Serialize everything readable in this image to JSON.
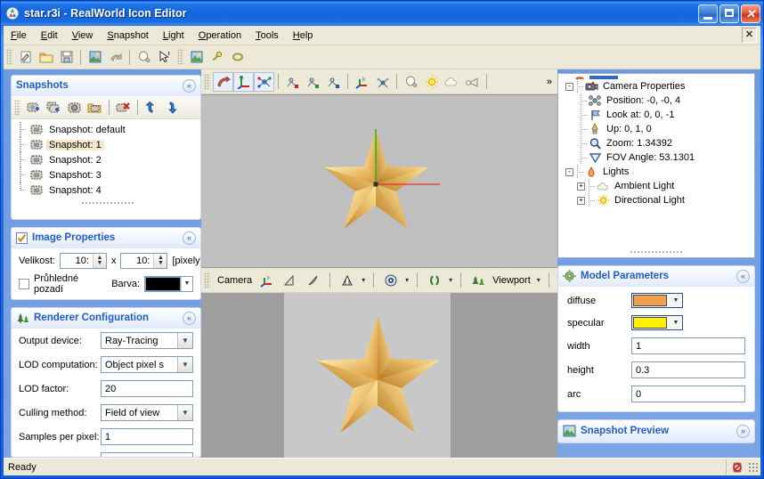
{
  "window": {
    "title": "star.r3i - RealWorld Icon Editor",
    "app_icon": "app-logo-icon",
    "minimize": "_",
    "maximize": "□",
    "close": "✕"
  },
  "menu": {
    "items": [
      {
        "label": "File",
        "accel": "F"
      },
      {
        "label": "Edit",
        "accel": "E"
      },
      {
        "label": "View",
        "accel": "V"
      },
      {
        "label": "Snapshot",
        "accel": "S"
      },
      {
        "label": "Light",
        "accel": "L"
      },
      {
        "label": "Operation",
        "accel": "O"
      },
      {
        "label": "Tools",
        "accel": "T"
      },
      {
        "label": "Help",
        "accel": "H"
      }
    ],
    "close_label": "✕"
  },
  "toolbar": {
    "buttons": [
      "new-document-icon",
      "open-folder-icon",
      "save-disk-icon",
      "export-image-icon",
      "undo-icon",
      "lightbulb-icon",
      "pointer-select-icon",
      "image-layer-icon",
      "tool-wand-icon",
      "loop-icon"
    ]
  },
  "snapshots_panel": {
    "title": "Snapshots",
    "collapse_glyph": "«",
    "toolbar_buttons": [
      "add-snapshot-icon",
      "duplicate-snapshot-icon",
      "edit-snapshot-icon",
      "open-snapshot-icon",
      "delete-snapshot-icon",
      "move-up-icon",
      "move-down-icon"
    ],
    "items": [
      {
        "label": "Snapshot: default",
        "selected": false
      },
      {
        "label": "Snapshot: 1",
        "selected": true
      },
      {
        "label": "Snapshot: 2",
        "selected": false
      },
      {
        "label": "Snapshot: 3",
        "selected": false
      },
      {
        "label": "Snapshot: 4",
        "selected": false
      }
    ]
  },
  "image_properties_panel": {
    "title": "Image Properties",
    "checkbox_icon": "checked-box-icon",
    "collapse_glyph": "«",
    "size_label": "Velikost:",
    "width_value": "10:",
    "separator": "x",
    "height_value": "10:",
    "units": "[pixely]",
    "transparent_label": "Průhledné pozadí",
    "transparent_checked": false,
    "color_label": "Barva:",
    "color_value": "#000000"
  },
  "renderer_panel": {
    "title": "Renderer Configuration",
    "icon": "trees-icon",
    "collapse_glyph": "«",
    "fields": [
      {
        "label": "Output device:",
        "value": "Ray-Tracing",
        "type": "select"
      },
      {
        "label": "LOD computation:",
        "value": "Object pixel s",
        "type": "select"
      },
      {
        "label": "LOD factor:",
        "value": "20",
        "type": "text"
      },
      {
        "label": "Culling method:",
        "value": "Field of view ",
        "type": "select"
      },
      {
        "label": "Samples per pixel:",
        "value": "1",
        "type": "text"
      }
    ]
  },
  "viewport": {
    "top_toolbar": [
      "rotate-object-icon",
      "move-axes-icon",
      "scale-object-icon",
      "rotate-x-icon",
      "rotate-y-icon",
      "rotate-z-icon",
      "translate-icon",
      "scatter-icon",
      "lightbulb-icon",
      "sun-light-icon",
      "ambient-cloud-icon",
      "spot-light-icon"
    ],
    "overflow_glyph": "»",
    "bottom_toolbar": {
      "camera_label": "Camera",
      "viewport_label": "Viewport",
      "buttons": [
        "axes-gizmo-icon",
        "camera-angle-icon",
        "camera-arc-icon",
        "render-mode-icon",
        "eye-view-icon",
        "stereo-icon",
        "trees-icon",
        "lightbulb-icon"
      ],
      "dropdown_glyph": "▾"
    },
    "background_color": "#bfbfbf",
    "preview_background": "#9e9e9e",
    "preview_canvas_color": "#c8c8c8",
    "model_color_light": "#ffe08a",
    "model_color_mid": "#f2b24e",
    "model_color_dark": "#c9822d",
    "axis_x_color": "#e03030",
    "axis_y_color": "#22c022"
  },
  "scene_tree": {
    "items": [
      {
        "label": "Camera Properties",
        "level": 0,
        "expander": "-",
        "icon": "camera-icon",
        "selected": false
      },
      {
        "label": "Position: -0, -0, 4",
        "level": 1,
        "expander": "",
        "icon": "position-icon",
        "selected": false
      },
      {
        "label": "Look at: 0, 0, -1",
        "level": 1,
        "expander": "",
        "icon": "lookat-flag-icon",
        "selected": false
      },
      {
        "label": "Up: 0, 1, 0",
        "level": 1,
        "expander": "",
        "icon": "up-arrow-icon",
        "selected": false
      },
      {
        "label": "Zoom: 1.34392",
        "level": 1,
        "expander": "",
        "icon": "magnifier-icon",
        "selected": false
      },
      {
        "label": "FOV Angle: 53.1301",
        "level": 1,
        "expander": "",
        "icon": "fov-cone-icon",
        "selected": false
      },
      {
        "label": "Lights",
        "level": 0,
        "expander": "-",
        "icon": "lights-icon",
        "selected": false
      },
      {
        "label": "Ambient Light",
        "level": 1,
        "expander": "+",
        "icon": "ambient-cloud-icon",
        "selected": false
      },
      {
        "label": "Directional Light",
        "level": 1,
        "expander": "+",
        "icon": "sun-light-icon",
        "selected": false
      }
    ]
  },
  "model_parameters_panel": {
    "title": "Model Parameters",
    "icon": "gear-icon",
    "collapse_glyph": "«",
    "rows": [
      {
        "label": "diffuse",
        "type": "color",
        "value": "#F0A050"
      },
      {
        "label": "specular",
        "type": "color",
        "value": "#FFF000"
      },
      {
        "label": "width",
        "type": "text",
        "value": "1"
      },
      {
        "label": "height",
        "type": "text",
        "value": "0.3"
      },
      {
        "label": "arc",
        "type": "text",
        "value": "0"
      }
    ]
  },
  "snapshot_preview_panel": {
    "title": "Snapshot Preview",
    "icon": "image-layer-icon",
    "expand_glyph": "»"
  },
  "statusbar": {
    "text": "Ready",
    "indicator_icon": "record-stop-icon"
  }
}
